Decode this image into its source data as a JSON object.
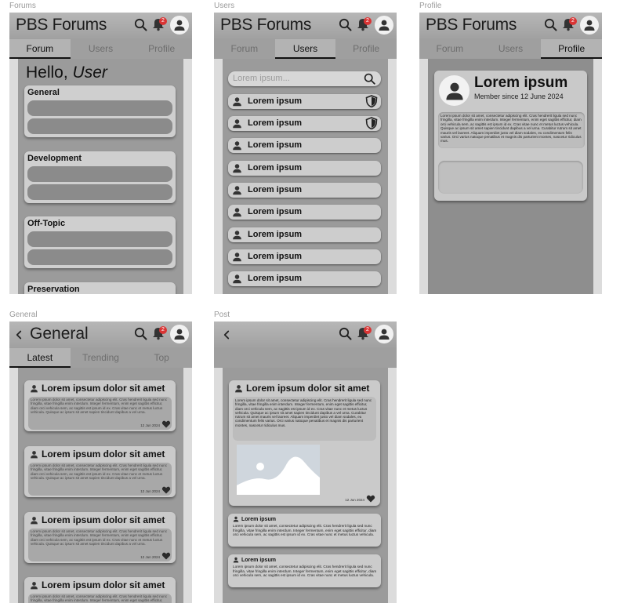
{
  "app_title": "PBS Forums",
  "badge_count": "2",
  "frames": {
    "forums": "Forums",
    "users": "Users",
    "profile": "Profile",
    "general": "General",
    "post": "Post"
  },
  "main_tabs": [
    "Forum",
    "Users",
    "Profile"
  ],
  "forum_screen": {
    "greeting": "Hello,",
    "greeting_name": "User",
    "categories": [
      "General",
      "Development",
      "Off-Topic",
      "Preservation"
    ]
  },
  "users_screen": {
    "search_placeholder": "Lorem ipsum...",
    "users": [
      {
        "name": "Lorem ipsum",
        "admin": true
      },
      {
        "name": "Lorem ipsum",
        "admin": true
      },
      {
        "name": "Lorem ipsum",
        "admin": false
      },
      {
        "name": "Lorem ipsum",
        "admin": false
      },
      {
        "name": "Lorem ipsum",
        "admin": false
      },
      {
        "name": "Lorem ipsum",
        "admin": false
      },
      {
        "name": "Lorem ipsum",
        "admin": false
      },
      {
        "name": "Lorem ipsum",
        "admin": false
      },
      {
        "name": "Lorem ipsum",
        "admin": false
      }
    ]
  },
  "profile_screen": {
    "name": "Lorem ipsum",
    "member_since": "Member since 12 June 2024",
    "bio": "Lorem ipsum dolor sit amet, consectetur adipiscing elit. Cras hendrerit ligula sed nunc fringilla, vitae fringilla enim interdum. Integer fermentum, enim eget sagittis efficitur, diam orci vehicula sem, ac sagittis est ipsum id ex. Cras vitae nunc et metus luctus vehicula. Quisque ac ipsum sit amet sapien tincidunt dapibus a vel urna. Curabitur rutrum sit amet mauris vel laoreet. Aliquam imperdiet justo vel diam sodales, eu condimentum felis varius. Orci varius natoque penatibus et magnis dis parturient montes, nascetur ridiculus mus."
  },
  "general_screen": {
    "title": "General",
    "tabs": [
      "Latest",
      "Trending",
      "Top"
    ],
    "post_title": "Lorem ipsum dolor sit amet",
    "post_snippet": "Lorem ipsum dolor sit amet, consectetur adipiscing elit. Cras hendrerit ligula sed nunc fringilla, vitae fringilla enim interdum. Integer fermentum, enim eget sagittis efficitur, diam orci vehicula sem, ac sagittis est ipsum id ex. Cras vitae nunc et metus luctus vehicula. Quisque ac ipsum sit amet sapien tincidunt dapibus a vel urna.",
    "post_date": "12 Jun 2024"
  },
  "post_screen": {
    "title": "Lorem ipsum dolor sit amet",
    "body": "Lorem ipsum dolor sit amet, consectetur adipiscing elit. Cras hendrerit ligula sed nunc fringilla, vitae fringilla enim interdum. Integer fermentum, enim eget sagittis efficitur, diam orci vehicula sem, ac sagittis est ipsum id ex. Cras vitae nunc et metus luctus vehicula. Quisque ac ipsum sit amet sapien tincidunt dapibus a vel urna. Curabitur rutrum sit amet mauris vel laoreet. Aliquam imperdiet justo vel diam sodales, eu condimentum felis varius. Orci varius natoque penatibus et magnis dis parturient montes, nascetur ridiculus mus.",
    "date": "12 Jun 2024",
    "replies": [
      {
        "author": "Lorem ipsum",
        "text": "Lorem ipsum dolor sit amet, consectetur adipiscing elit. Cras hendrerit ligula sed nunc fringilla, vitae fringilla enim interdum. Integer fermentum, enim eget sagittis efficitur, diam orci vehicula sem, ac sagittis est ipsum id ex. Cras vitae nunc et metus luctus vehicula."
      },
      {
        "author": "Lorem ipsum",
        "text": "Lorem ipsum dolor sit amet, consectetur adipiscing elit. Cras hendrerit ligula sed nunc fringilla, vitae fringilla enim interdum. Integer fermentum, enim eget sagittis efficitur, diam orci vehicula sem, ac sagittis est ipsum id ex. Cras vitae nunc et metus luctus vehicula."
      }
    ]
  }
}
